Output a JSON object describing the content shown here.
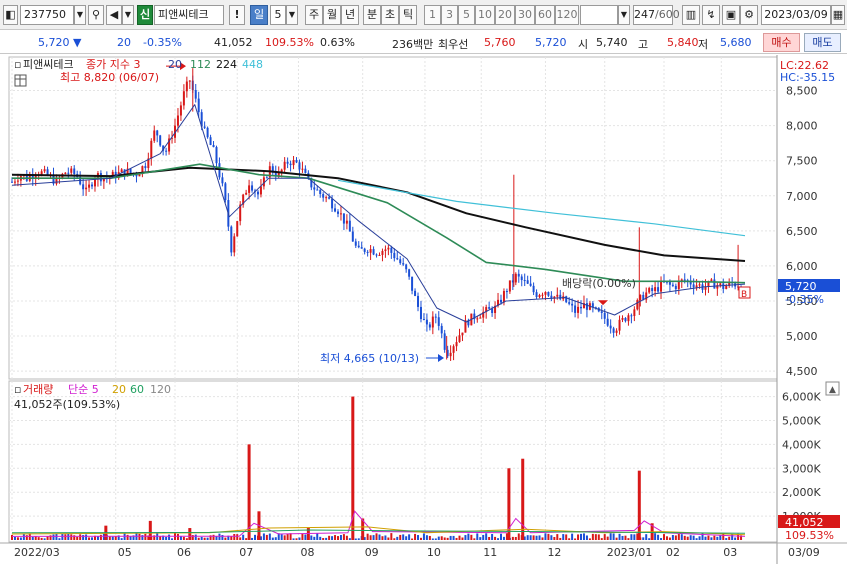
{
  "toolbar": {
    "code": "237750",
    "market_badge": "신",
    "stock_name": "피앤씨테크",
    "bang_label": "!",
    "period_selected": "일",
    "period_count": "5",
    "periods": [
      "주",
      "월",
      "년",
      "분",
      "초",
      "틱"
    ],
    "intervals": [
      "1",
      "3",
      "5",
      "10",
      "20",
      "30",
      "60",
      "120"
    ],
    "range_value": "247",
    "range_total": "/600",
    "date": "2023/03/09"
  },
  "quote": {
    "price": "5,720",
    "change_arrow": "▼",
    "change": "20",
    "change_pct": "-0.35%",
    "volume": "41,052",
    "volume_ratio": "109.53%",
    "turnover": "0.63%",
    "amount": "236백만",
    "best_ask_label": "최우선",
    "best_ask": "5,760",
    "best_bid": "5,720",
    "open_label": "시",
    "open": "5,740",
    "high_label": "고",
    "high": "5,840",
    "low_label": "저",
    "low": "5,680",
    "buy_label": "매수",
    "sell_label": "매도"
  },
  "colors": {
    "up": "#d81818",
    "down": "#1a4fd6",
    "ma5": "#2a3f9a",
    "ma20": "#2e8b57",
    "ma112": "#111111",
    "ma224": "#40c0d8",
    "vol_ma5": "#d020d0",
    "vol_ma20": "#d0a000",
    "vol_ma60": "#20a060"
  },
  "chart_data": [
    {
      "type": "candlestick",
      "title": "피앤씨테크",
      "legend": [
        "종가 지수 3",
        "20",
        "112",
        "224",
        "448"
      ],
      "y_ticks": [
        "8,500",
        "8,000",
        "7,500",
        "7,000",
        "6,500",
        "6,000",
        "5,500",
        "5,000",
        "4,500"
      ],
      "y_values": [
        8500,
        8000,
        7500,
        7000,
        6500,
        6000,
        5500,
        5000,
        4500
      ],
      "ylim": [
        4430,
        8950
      ],
      "x_ticks": [
        "2022/03",
        "05",
        "06",
        "07",
        "08",
        "09",
        "10",
        "11",
        "12",
        "2023/01",
        "02",
        "03",
        "03/09"
      ],
      "annotations": {
        "high": "최고 8,820 (06/07)",
        "low": "최저 4,665 (10/13)",
        "dividend": "배당락(0.00%)",
        "lc": "LC:22.62",
        "hc": "HC:-35.15",
        "current_price": "5,720",
        "current_change": "-0.35%",
        "marker": "B"
      },
      "close_series": [
        [
          0,
          7200
        ],
        [
          8,
          7300
        ],
        [
          15,
          7250
        ],
        [
          25,
          7350
        ],
        [
          35,
          7300
        ],
        [
          45,
          7200
        ],
        [
          55,
          7350
        ],
        [
          65,
          7300
        ],
        [
          75,
          7050
        ],
        [
          85,
          7300
        ],
        [
          95,
          7250
        ],
        [
          105,
          7300
        ],
        [
          115,
          7350
        ],
        [
          125,
          7300
        ],
        [
          135,
          7450
        ],
        [
          145,
          7950
        ],
        [
          155,
          7600
        ],
        [
          165,
          8000
        ],
        [
          175,
          8500
        ],
        [
          180,
          8650
        ],
        [
          185,
          8400
        ],
        [
          195,
          7900
        ],
        [
          205,
          7600
        ],
        [
          215,
          7000
        ],
        [
          222,
          6250
        ],
        [
          230,
          6800
        ],
        [
          240,
          7200
        ],
        [
          250,
          7000
        ],
        [
          260,
          7400
        ],
        [
          270,
          7300
        ],
        [
          280,
          7500
        ],
        [
          290,
          7450
        ],
        [
          300,
          7200
        ],
        [
          310,
          7050
        ],
        [
          320,
          6950
        ],
        [
          330,
          6800
        ],
        [
          340,
          6550
        ],
        [
          350,
          6200
        ],
        [
          360,
          6250
        ],
        [
          370,
          6200
        ],
        [
          380,
          6250
        ],
        [
          390,
          6100
        ],
        [
          400,
          5900
        ],
        [
          410,
          5450
        ],
        [
          420,
          5100
        ],
        [
          430,
          5300
        ],
        [
          440,
          4750
        ],
        [
          450,
          4950
        ],
        [
          460,
          5200
        ],
        [
          470,
          5300
        ],
        [
          480,
          5350
        ],
        [
          490,
          5400
        ],
        [
          500,
          5650
        ],
        [
          510,
          5850
        ],
        [
          520,
          5750
        ],
        [
          530,
          5600
        ],
        [
          540,
          5650
        ],
        [
          550,
          5550
        ],
        [
          560,
          5500
        ],
        [
          570,
          5350
        ],
        [
          580,
          5450
        ],
        [
          590,
          5350
        ],
        [
          600,
          5250
        ],
        [
          610,
          5100
        ],
        [
          620,
          5250
        ],
        [
          630,
          5400
        ],
        [
          640,
          5600
        ],
        [
          650,
          5650
        ],
        [
          660,
          5750
        ],
        [
          670,
          5700
        ],
        [
          680,
          5800
        ],
        [
          690,
          5750
        ],
        [
          700,
          5700
        ],
        [
          710,
          5750
        ],
        [
          720,
          5700
        ],
        [
          730,
          5750
        ],
        [
          740,
          5720
        ]
      ],
      "ma_series": {
        "ma112": [
          [
            0,
            7300
          ],
          [
            100,
            7280
          ],
          [
            180,
            7400
          ],
          [
            260,
            7350
          ],
          [
            330,
            7250
          ],
          [
            400,
            7050
          ],
          [
            460,
            6750
          ],
          [
            520,
            6550
          ],
          [
            600,
            6300
          ],
          [
            660,
            6150
          ],
          [
            742,
            6070
          ]
        ],
        "ma224": [
          [
            330,
            7220
          ],
          [
            450,
            6920
          ],
          [
            550,
            6750
          ],
          [
            650,
            6600
          ],
          [
            742,
            6430
          ]
        ],
        "ma20": [
          [
            0,
            7250
          ],
          [
            100,
            7250
          ],
          [
            190,
            7450
          ],
          [
            250,
            7300
          ],
          [
            300,
            7250
          ],
          [
            380,
            6900
          ],
          [
            440,
            6400
          ],
          [
            480,
            6050
          ],
          [
            540,
            5950
          ],
          [
            620,
            5780
          ],
          [
            680,
            5780
          ],
          [
            742,
            5760
          ]
        ],
        "ma5": [
          [
            0,
            7150
          ],
          [
            100,
            7250
          ],
          [
            150,
            7600
          ],
          [
            185,
            8300
          ],
          [
            220,
            6700
          ],
          [
            260,
            7250
          ],
          [
            300,
            7250
          ],
          [
            350,
            6650
          ],
          [
            400,
            6100
          ],
          [
            430,
            5400
          ],
          [
            460,
            5200
          ],
          [
            500,
            5500
          ],
          [
            560,
            5550
          ],
          [
            610,
            5300
          ],
          [
            650,
            5600
          ],
          [
            700,
            5700
          ],
          [
            742,
            5740
          ]
        ]
      }
    },
    {
      "type": "bar",
      "title": "거래량",
      "legend": [
        "거래량",
        "단순 5",
        "20",
        "60",
        "120"
      ],
      "subtitle": "41,052주(109.53%)",
      "y_ticks": [
        "6,000K",
        "5,000K",
        "4,000K",
        "3,000K",
        "2,000K",
        "1,000K"
      ],
      "y_values": [
        6000,
        5000,
        4000,
        3000,
        2000,
        1000
      ],
      "ylim": [
        0,
        6400
      ],
      "current_volume": "41,052",
      "current_ratio": "109.53%",
      "spikes": [
        [
          95,
          600,
          "up"
        ],
        [
          140,
          800,
          "up"
        ],
        [
          180,
          500,
          "up"
        ],
        [
          240,
          4000,
          "up"
        ],
        [
          250,
          1200,
          "up"
        ],
        [
          300,
          500,
          "up"
        ],
        [
          345,
          6000,
          "up"
        ],
        [
          355,
          900,
          "up"
        ],
        [
          503,
          3000,
          "up"
        ],
        [
          517,
          3400,
          "up"
        ],
        [
          635,
          2900,
          "up"
        ],
        [
          648,
          700,
          "up"
        ]
      ]
    }
  ]
}
